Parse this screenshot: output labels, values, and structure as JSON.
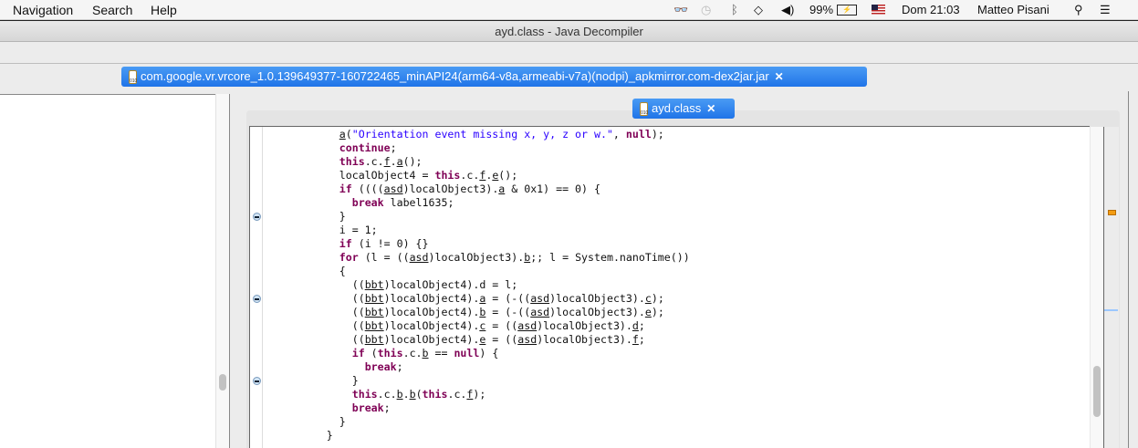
{
  "menubar": {
    "items": [
      "Navigation",
      "Search",
      "Help"
    ],
    "status": {
      "battery": "99%",
      "clock": "Dom 21:03",
      "user": "Matteo Pisani"
    },
    "icons": [
      "glasses-icon",
      "time-machine-icon",
      "bluetooth-icon",
      "wifi-icon",
      "volume-icon",
      "battery-icon",
      "flag-icon",
      "spotlight-icon",
      "notification-center-icon"
    ]
  },
  "window": {
    "title": "ayd.class - Java Decompiler"
  },
  "tabs": {
    "jar": "com.google.vr.vrcore_1.0.139649377-160722465_minAPI24(arm64-v8a,armeabi-v7a)(nodpi)_apkmirror.com-dex2jar.jar",
    "class": "ayd.class",
    "close": "✕"
  },
  "colors": {
    "keyword": "#7f0055",
    "string": "#2a00ff",
    "tab": "#2a7ff0"
  },
  "code": [
    [
      [
        "            "
      ],
      [
        "a",
        "u"
      ],
      [
        "("
      ],
      [
        "\"Orientation event missing x, y, z or w.\"",
        "str"
      ],
      [
        ", "
      ],
      [
        "null",
        "kw"
      ],
      [
        ");"
      ]
    ],
    [
      [
        "            "
      ],
      [
        "continue",
        "kw"
      ],
      [
        ";"
      ]
    ],
    [
      [
        "            "
      ],
      [
        "this",
        "kw"
      ],
      [
        ".c."
      ],
      [
        "f",
        "u"
      ],
      [
        "."
      ],
      [
        "a",
        "u"
      ],
      [
        "();"
      ]
    ],
    [
      [
        "            localObject4 = "
      ],
      [
        "this",
        "kw"
      ],
      [
        ".c."
      ],
      [
        "f",
        "u"
      ],
      [
        "."
      ],
      [
        "e",
        "u"
      ],
      [
        "();"
      ]
    ],
    [
      [
        "            "
      ],
      [
        "if",
        "kw"
      ],
      [
        " (((("
      ],
      [
        "asd",
        "u"
      ],
      [
        ")localObject3)."
      ],
      [
        "a",
        "u"
      ],
      [
        " & 0x1) == 0) {"
      ]
    ],
    [
      [
        "              "
      ],
      [
        "break",
        "kw"
      ],
      [
        " label1635;"
      ]
    ],
    [
      [
        "            }"
      ]
    ],
    [
      [
        "            i = 1;"
      ]
    ],
    [
      [
        "            "
      ],
      [
        "if",
        "kw"
      ],
      [
        " (i != 0) {}"
      ]
    ],
    [
      [
        "            "
      ],
      [
        "for",
        "kw"
      ],
      [
        " (l = (("
      ],
      [
        "asd",
        "u"
      ],
      [
        ")localObject3)."
      ],
      [
        "b",
        "u"
      ],
      [
        ";; l = System.nanoTime())"
      ]
    ],
    [
      [
        "            {"
      ]
    ],
    [
      [
        "              (("
      ],
      [
        "bbt",
        "u"
      ],
      [
        ")localObject4).d = l;"
      ]
    ],
    [
      [
        "              (("
      ],
      [
        "bbt",
        "u"
      ],
      [
        ")localObject4)."
      ],
      [
        "a",
        "u"
      ],
      [
        " = (-(("
      ],
      [
        "asd",
        "u"
      ],
      [
        ")localObject3)."
      ],
      [
        "c",
        "u"
      ],
      [
        ");"
      ]
    ],
    [
      [
        "              (("
      ],
      [
        "bbt",
        "u"
      ],
      [
        ")localObject4)."
      ],
      [
        "b",
        "u"
      ],
      [
        " = (-(("
      ],
      [
        "asd",
        "u"
      ],
      [
        ")localObject3)."
      ],
      [
        "e",
        "u"
      ],
      [
        ");"
      ]
    ],
    [
      [
        "              (("
      ],
      [
        "bbt",
        "u"
      ],
      [
        ")localObject4)."
      ],
      [
        "c",
        "u"
      ],
      [
        " = (("
      ],
      [
        "asd",
        "u"
      ],
      [
        ")localObject3)."
      ],
      [
        "d",
        "u"
      ],
      [
        ";"
      ]
    ],
    [
      [
        "              (("
      ],
      [
        "bbt",
        "u"
      ],
      [
        ")localObject4)."
      ],
      [
        "e",
        "u"
      ],
      [
        " = (("
      ],
      [
        "asd",
        "u"
      ],
      [
        ")localObject3)."
      ],
      [
        "f",
        "u"
      ],
      [
        ";"
      ]
    ],
    [
      [
        "              "
      ],
      [
        "if",
        "kw"
      ],
      [
        " ("
      ],
      [
        "this",
        "kw"
      ],
      [
        ".c."
      ],
      [
        "b",
        "u"
      ],
      [
        " == "
      ],
      [
        "null",
        "kw"
      ],
      [
        ") {"
      ]
    ],
    [
      [
        "                "
      ],
      [
        "break",
        "kw"
      ],
      [
        ";"
      ]
    ],
    [
      [
        "              }"
      ]
    ],
    [
      [
        "              "
      ],
      [
        "this",
        "kw"
      ],
      [
        ".c."
      ],
      [
        "b",
        "u"
      ],
      [
        "."
      ],
      [
        "b",
        "u"
      ],
      [
        "("
      ],
      [
        "this",
        "kw"
      ],
      [
        ".c."
      ],
      [
        "f",
        "u"
      ],
      [
        ");"
      ]
    ],
    [
      [
        "              "
      ],
      [
        "break",
        "kw"
      ],
      [
        ";"
      ]
    ],
    [
      [
        "            }"
      ]
    ],
    [
      [
        "          }"
      ]
    ]
  ]
}
